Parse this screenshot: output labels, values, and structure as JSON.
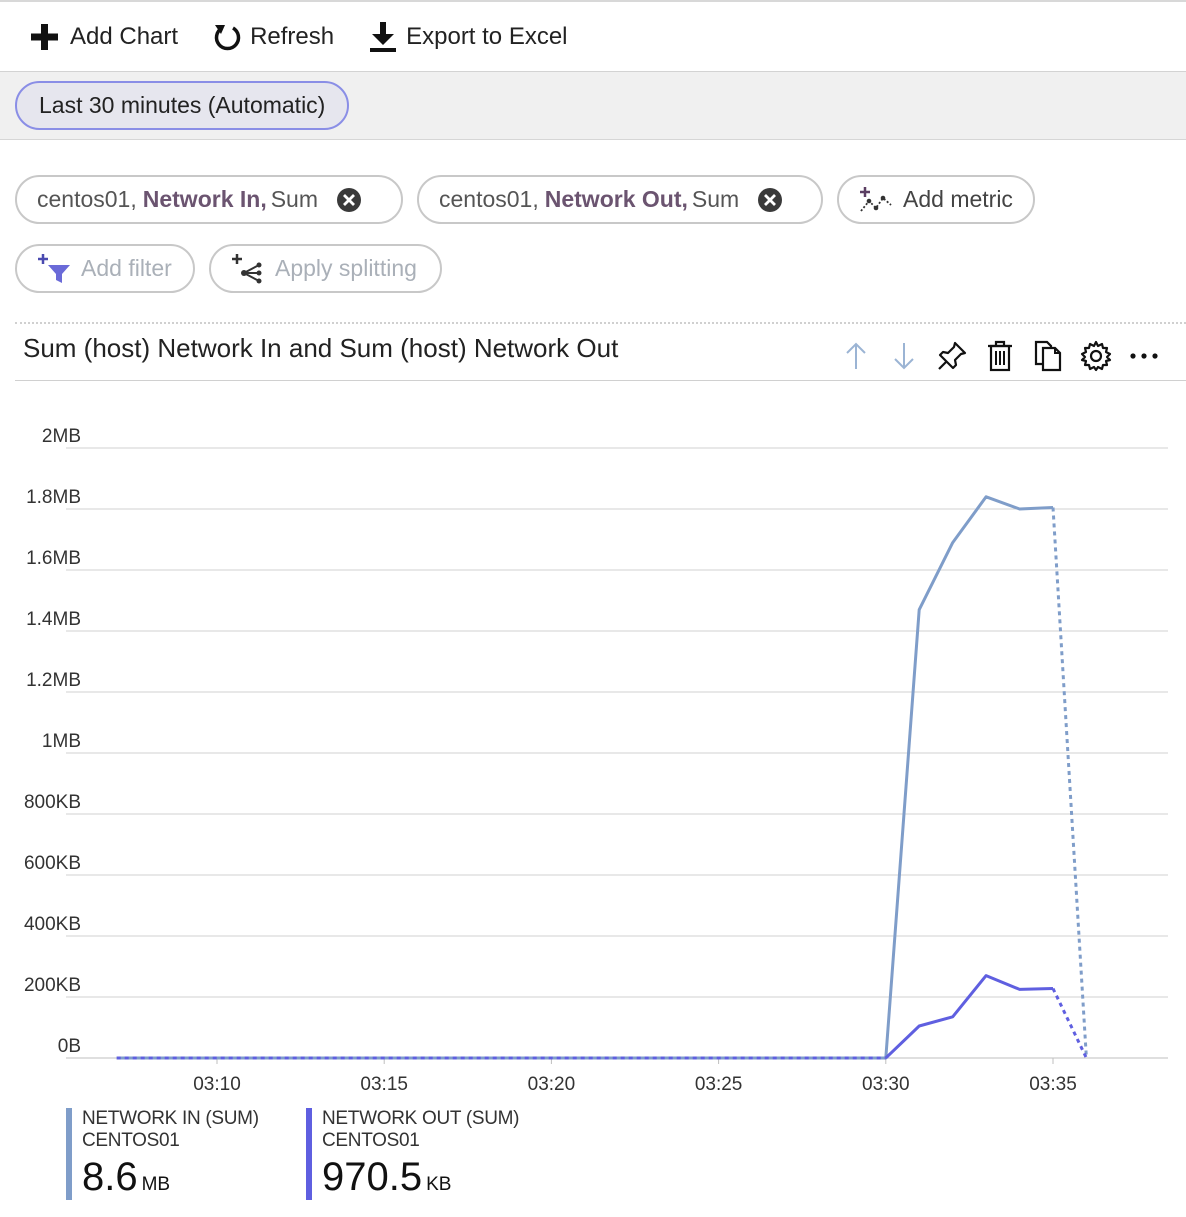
{
  "toolbar": {
    "add_chart": "Add Chart",
    "refresh": "Refresh",
    "export": "Export to Excel"
  },
  "time_range": {
    "label": "Last 30 minutes (Automatic)"
  },
  "metrics": [
    {
      "resource": "centos01,",
      "metric": "Network In,",
      "agg": "Sum"
    },
    {
      "resource": "centos01,",
      "metric": "Network Out,",
      "agg": "Sum"
    }
  ],
  "actions": {
    "add_metric": "Add metric",
    "add_filter": "Add filter",
    "apply_splitting": "Apply splitting"
  },
  "chart_title": "Sum (host) Network In and Sum (host) Network Out",
  "chart_data": {
    "type": "line",
    "x_ticks": [
      "03:10",
      "03:15",
      "03:20",
      "03:25",
      "03:30",
      "03:35"
    ],
    "y_ticks": [
      "0B",
      "200KB",
      "400KB",
      "600KB",
      "800KB",
      "1MB",
      "1.2MB",
      "1.4MB",
      "1.6MB",
      "1.8MB",
      "2MB"
    ],
    "ylim_kb": [
      0,
      2000
    ],
    "grid": true,
    "x_minutes": [
      "03:07",
      "03:08",
      "03:09",
      "03:10",
      "03:11",
      "03:12",
      "03:13",
      "03:14",
      "03:15",
      "03:16",
      "03:17",
      "03:18",
      "03:19",
      "03:20",
      "03:21",
      "03:22",
      "03:23",
      "03:24",
      "03:25",
      "03:26",
      "03:27",
      "03:28",
      "03:29",
      "03:30",
      "03:31",
      "03:32",
      "03:33",
      "03:34",
      "03:35",
      "03:36"
    ],
    "series": [
      {
        "name": "NETWORK IN (SUM)",
        "color": "#7f9dc9",
        "values_kb": [
          0,
          0,
          0,
          0,
          0,
          0,
          0,
          0,
          0,
          0,
          0,
          0,
          0,
          0,
          0,
          0,
          0,
          0,
          0,
          0,
          0,
          0,
          0,
          0,
          1470,
          1690,
          1840,
          1800,
          1805,
          0
        ],
        "dashed_from_index": 28
      },
      {
        "name": "NETWORK OUT (SUM)",
        "color": "#5f5fe0",
        "values_kb": [
          0,
          0,
          0,
          0,
          0,
          0,
          0,
          0,
          0,
          0,
          0,
          0,
          0,
          0,
          0,
          0,
          0,
          0,
          0,
          0,
          0,
          0,
          0,
          0,
          105,
          135,
          270,
          225,
          228,
          0
        ],
        "dashed_until_index": 23,
        "dashed_from_index": 28
      }
    ]
  },
  "legend": [
    {
      "name": "NETWORK IN (SUM)",
      "resource": "CENTOS01",
      "value": "8.6",
      "unit": "MB",
      "color": "#7f9dc9"
    },
    {
      "name": "NETWORK OUT (SUM)",
      "resource": "CENTOS01",
      "value": "970.5",
      "unit": "KB",
      "color": "#5f5fe0"
    }
  ]
}
